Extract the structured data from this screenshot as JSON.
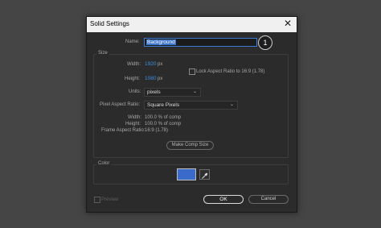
{
  "dialog": {
    "title": "Solid Settings",
    "close_glyph": "✕",
    "name_label": "Name:",
    "name_value": "Background",
    "step_badge": "1"
  },
  "size": {
    "section_label": "Size",
    "width_label": "Width:",
    "width_value": "1920",
    "width_unit": "px",
    "height_label": "Height:",
    "height_value": "1080",
    "height_unit": "px",
    "lock_label": "Lock Aspect Ratio to 16:9 (1.78)",
    "lock_checked": false,
    "units_label": "Units:",
    "units_value": "pixels",
    "par_label": "Pixel Aspect Ratio:",
    "par_value": "Square Pixels",
    "info_width_label": "Width:",
    "info_width_value": "100.0 % of comp",
    "info_height_label": "Height:",
    "info_height_value": "100.0 % of comp",
    "info_far_label": "Frame Aspect Ratio:",
    "info_far_value": "16:9 (1.78)",
    "make_comp_size_label": "Make Comp Size"
  },
  "color": {
    "section_label": "Color",
    "swatch_color": "#3a6bcb"
  },
  "footer": {
    "preview_label": "Preview",
    "preview_checked": false,
    "ok_label": "OK",
    "cancel_label": "Cancel"
  },
  "theme": {
    "accent": "#3b8fe4",
    "dialog_bg": "#2b2b2b",
    "backdrop": "#454545"
  }
}
